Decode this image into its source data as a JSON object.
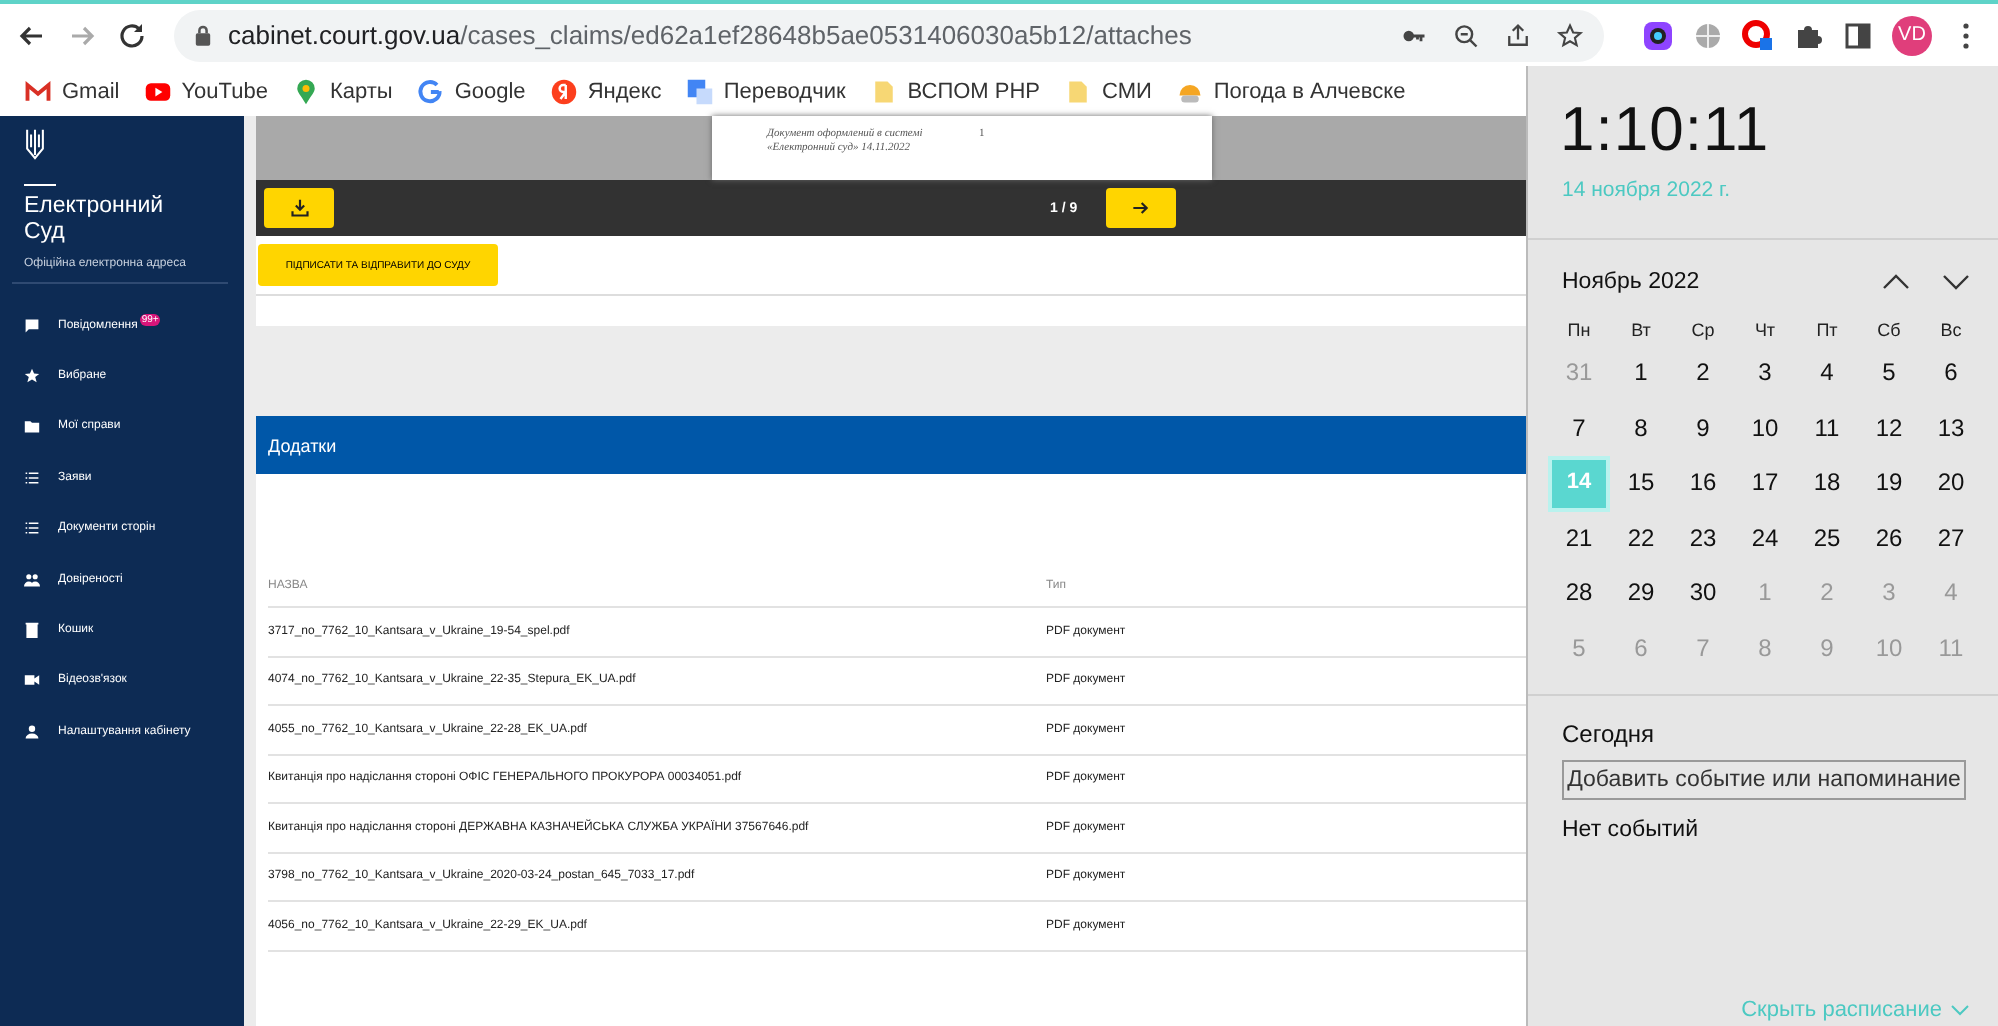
{
  "browser": {
    "url_host": "cabinet.court.gov.ua",
    "url_path": "/cases_claims/ed62a1ef28648b5ae0531406030a5b12/attaches",
    "avatar": "VD"
  },
  "bookmarks": [
    {
      "label": "Gmail",
      "kind": "gmail"
    },
    {
      "label": "YouTube",
      "kind": "youtube"
    },
    {
      "label": "Карты",
      "kind": "maps"
    },
    {
      "label": "Google",
      "kind": "google"
    },
    {
      "label": "Яндекс",
      "kind": "yandex"
    },
    {
      "label": "Переводчик",
      "kind": "translate"
    },
    {
      "label": "ВСПОМ РНР",
      "kind": "folder"
    },
    {
      "label": "СМИ",
      "kind": "folder"
    },
    {
      "label": "Погода в Алчевске",
      "kind": "weather"
    }
  ],
  "sidebar": {
    "title": "Електронний Суд",
    "subtitle": "Офіційна електронна адреса",
    "items": [
      {
        "label": "Повідомлення",
        "badge": "99+"
      },
      {
        "label": "Вибране"
      },
      {
        "label": "Мої справи"
      },
      {
        "label": "Заяви"
      },
      {
        "label": "Документи сторін"
      },
      {
        "label": "Довіреності"
      },
      {
        "label": "Кошик"
      },
      {
        "label": "Відеозв'язок"
      },
      {
        "label": "Налаштування кабінету"
      }
    ]
  },
  "preview": {
    "stamp_lines": [
      "Документ оформлений в системі",
      "«Електронний суд» 14.11.2022"
    ],
    "page_number": "1",
    "pager": "1 / 9",
    "sign_button": "ПІДПИСАТИ ТА ВІДПРАВИТИ ДО СУДУ"
  },
  "attachments": {
    "title": "Додатки",
    "columns": [
      "НАЗВА",
      "Тип"
    ],
    "rows": [
      [
        "3717_no_7762_10_Kantsara_v_Ukraine_19-54_spel.pdf",
        "PDF документ"
      ],
      [
        "4074_no_7762_10_Kantsara_v_Ukraine_22-35_Stepura_EK_UA.pdf",
        "PDF документ"
      ],
      [
        "4055_no_7762_10_Kantsara_v_Ukraine_22-28_EK_UA.pdf",
        "PDF документ"
      ],
      [
        "Квитанція про надіслання стороні ОФІС ГЕНЕРАЛЬНОГО ПРОКУРОРА 00034051.pdf",
        "PDF документ"
      ],
      [
        "Квитанція про надіслання стороні ДЕРЖАВНА КАЗНАЧЕЙСЬКА СЛУЖБА УКРАЇНИ 37567646.pdf",
        "PDF документ"
      ],
      [
        "3798_no_7762_10_Kantsara_v_Ukraine_2020-03-24_postan_645_7033_17.pdf",
        "PDF документ"
      ],
      [
        "4056_no_7762_10_Kantsara_v_Ukraine_22-29_EK_UA.pdf",
        "PDF документ"
      ]
    ]
  },
  "calendar": {
    "time": "1:10:11",
    "date": "14 ноября 2022 г.",
    "month": "Ноябрь 2022",
    "weekdays": [
      "Пн",
      "Вт",
      "Ср",
      "Чт",
      "Пт",
      "Сб",
      "Вс"
    ],
    "days": [
      {
        "label": "31",
        "current_month": false,
        "selected": false
      },
      {
        "label": "1",
        "current_month": true,
        "selected": false
      },
      {
        "label": "2",
        "current_month": true,
        "selected": false
      },
      {
        "label": "3",
        "current_month": true,
        "selected": false
      },
      {
        "label": "4",
        "current_month": true,
        "selected": false
      },
      {
        "label": "5",
        "current_month": true,
        "selected": false
      },
      {
        "label": "6",
        "current_month": true,
        "selected": false
      },
      {
        "label": "7",
        "current_month": true,
        "selected": false
      },
      {
        "label": "8",
        "current_month": true,
        "selected": false
      },
      {
        "label": "9",
        "current_month": true,
        "selected": false
      },
      {
        "label": "10",
        "current_month": true,
        "selected": false
      },
      {
        "label": "11",
        "current_month": true,
        "selected": false
      },
      {
        "label": "12",
        "current_month": true,
        "selected": false
      },
      {
        "label": "13",
        "current_month": true,
        "selected": false
      },
      {
        "label": "14",
        "current_month": true,
        "selected": true
      },
      {
        "label": "15",
        "current_month": true,
        "selected": false
      },
      {
        "label": "16",
        "current_month": true,
        "selected": false
      },
      {
        "label": "17",
        "current_month": true,
        "selected": false
      },
      {
        "label": "18",
        "current_month": true,
        "selected": false
      },
      {
        "label": "19",
        "current_month": true,
        "selected": false
      },
      {
        "label": "20",
        "current_month": true,
        "selected": false
      },
      {
        "label": "21",
        "current_month": true,
        "selected": false
      },
      {
        "label": "22",
        "current_month": true,
        "selected": false
      },
      {
        "label": "23",
        "current_month": true,
        "selected": false
      },
      {
        "label": "24",
        "current_month": true,
        "selected": false
      },
      {
        "label": "25",
        "current_month": true,
        "selected": false
      },
      {
        "label": "26",
        "current_month": true,
        "selected": false
      },
      {
        "label": "27",
        "current_month": true,
        "selected": false
      },
      {
        "label": "28",
        "current_month": true,
        "selected": false
      },
      {
        "label": "29",
        "current_month": true,
        "selected": false
      },
      {
        "label": "30",
        "current_month": true,
        "selected": false
      },
      {
        "label": "1",
        "current_month": false,
        "selected": false
      },
      {
        "label": "2",
        "current_month": false,
        "selected": false
      },
      {
        "label": "3",
        "current_month": false,
        "selected": false
      },
      {
        "label": "4",
        "current_month": false,
        "selected": false
      },
      {
        "label": "5",
        "current_month": false,
        "selected": false
      },
      {
        "label": "6",
        "current_month": false,
        "selected": false
      },
      {
        "label": "7",
        "current_month": false,
        "selected": false
      },
      {
        "label": "8",
        "current_month": false,
        "selected": false
      },
      {
        "label": "9",
        "current_month": false,
        "selected": false
      },
      {
        "label": "10",
        "current_month": false,
        "selected": false
      },
      {
        "label": "11",
        "current_month": false,
        "selected": false
      }
    ],
    "today_label": "Сегодня",
    "add_button": "Добавить событие или напоминание",
    "no_events": "Нет событий",
    "hide_link": "Скрыть расписание"
  }
}
